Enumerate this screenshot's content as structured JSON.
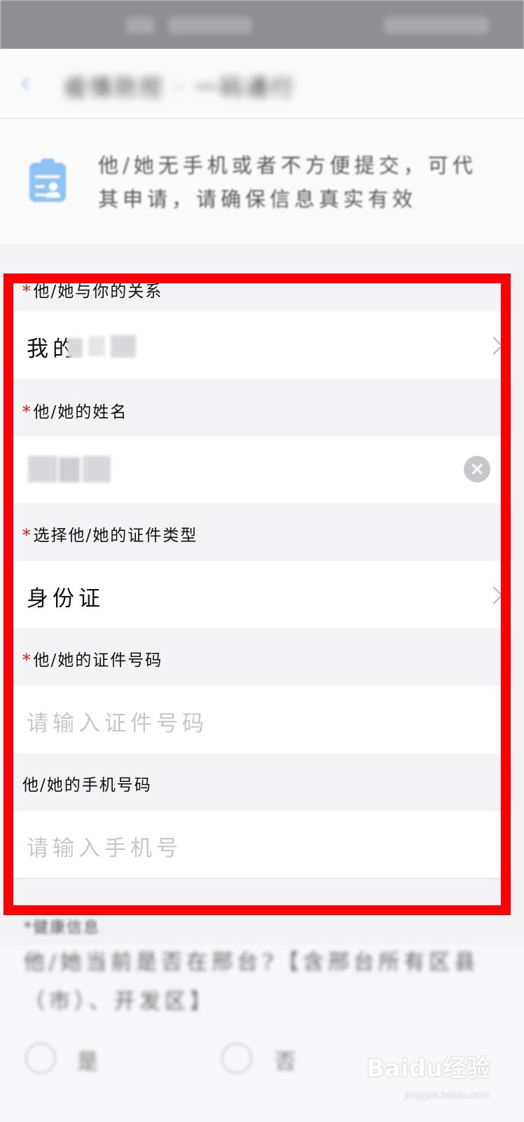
{
  "header": {
    "title": "疫情防控 · 一码通行",
    "back_icon": "chevron-left-icon"
  },
  "notice": {
    "icon": "clipboard-user-icon",
    "text": "他/她无手机或者不方便提交，可代其申请，请确保信息真实有效"
  },
  "form": {
    "relation": {
      "label": "他/她与你的关系",
      "value": "我的"
    },
    "name": {
      "label": "他/她的姓名",
      "value": ""
    },
    "id_type": {
      "label": "选择他/她的证件类型",
      "value": "身份证"
    },
    "id_number": {
      "label": "他/她的证件号码",
      "placeholder": "请输入证件号码"
    },
    "phone": {
      "label": "他/她的手机号码",
      "placeholder": "请输入手机号"
    },
    "required_mark": "*"
  },
  "health": {
    "label": "*健康信息",
    "question": "他/她当前是否在邢台?【含邢台所有区县（市）、开发区】",
    "option_yes": "是",
    "option_no": "否"
  },
  "watermark": {
    "brand": "Baidu经验",
    "url": "jingyan.baidu.com"
  },
  "colors": {
    "highlight_frame": "#ff0000",
    "required_mark": "#d8181d",
    "page_bg": "#f3f2f5"
  }
}
